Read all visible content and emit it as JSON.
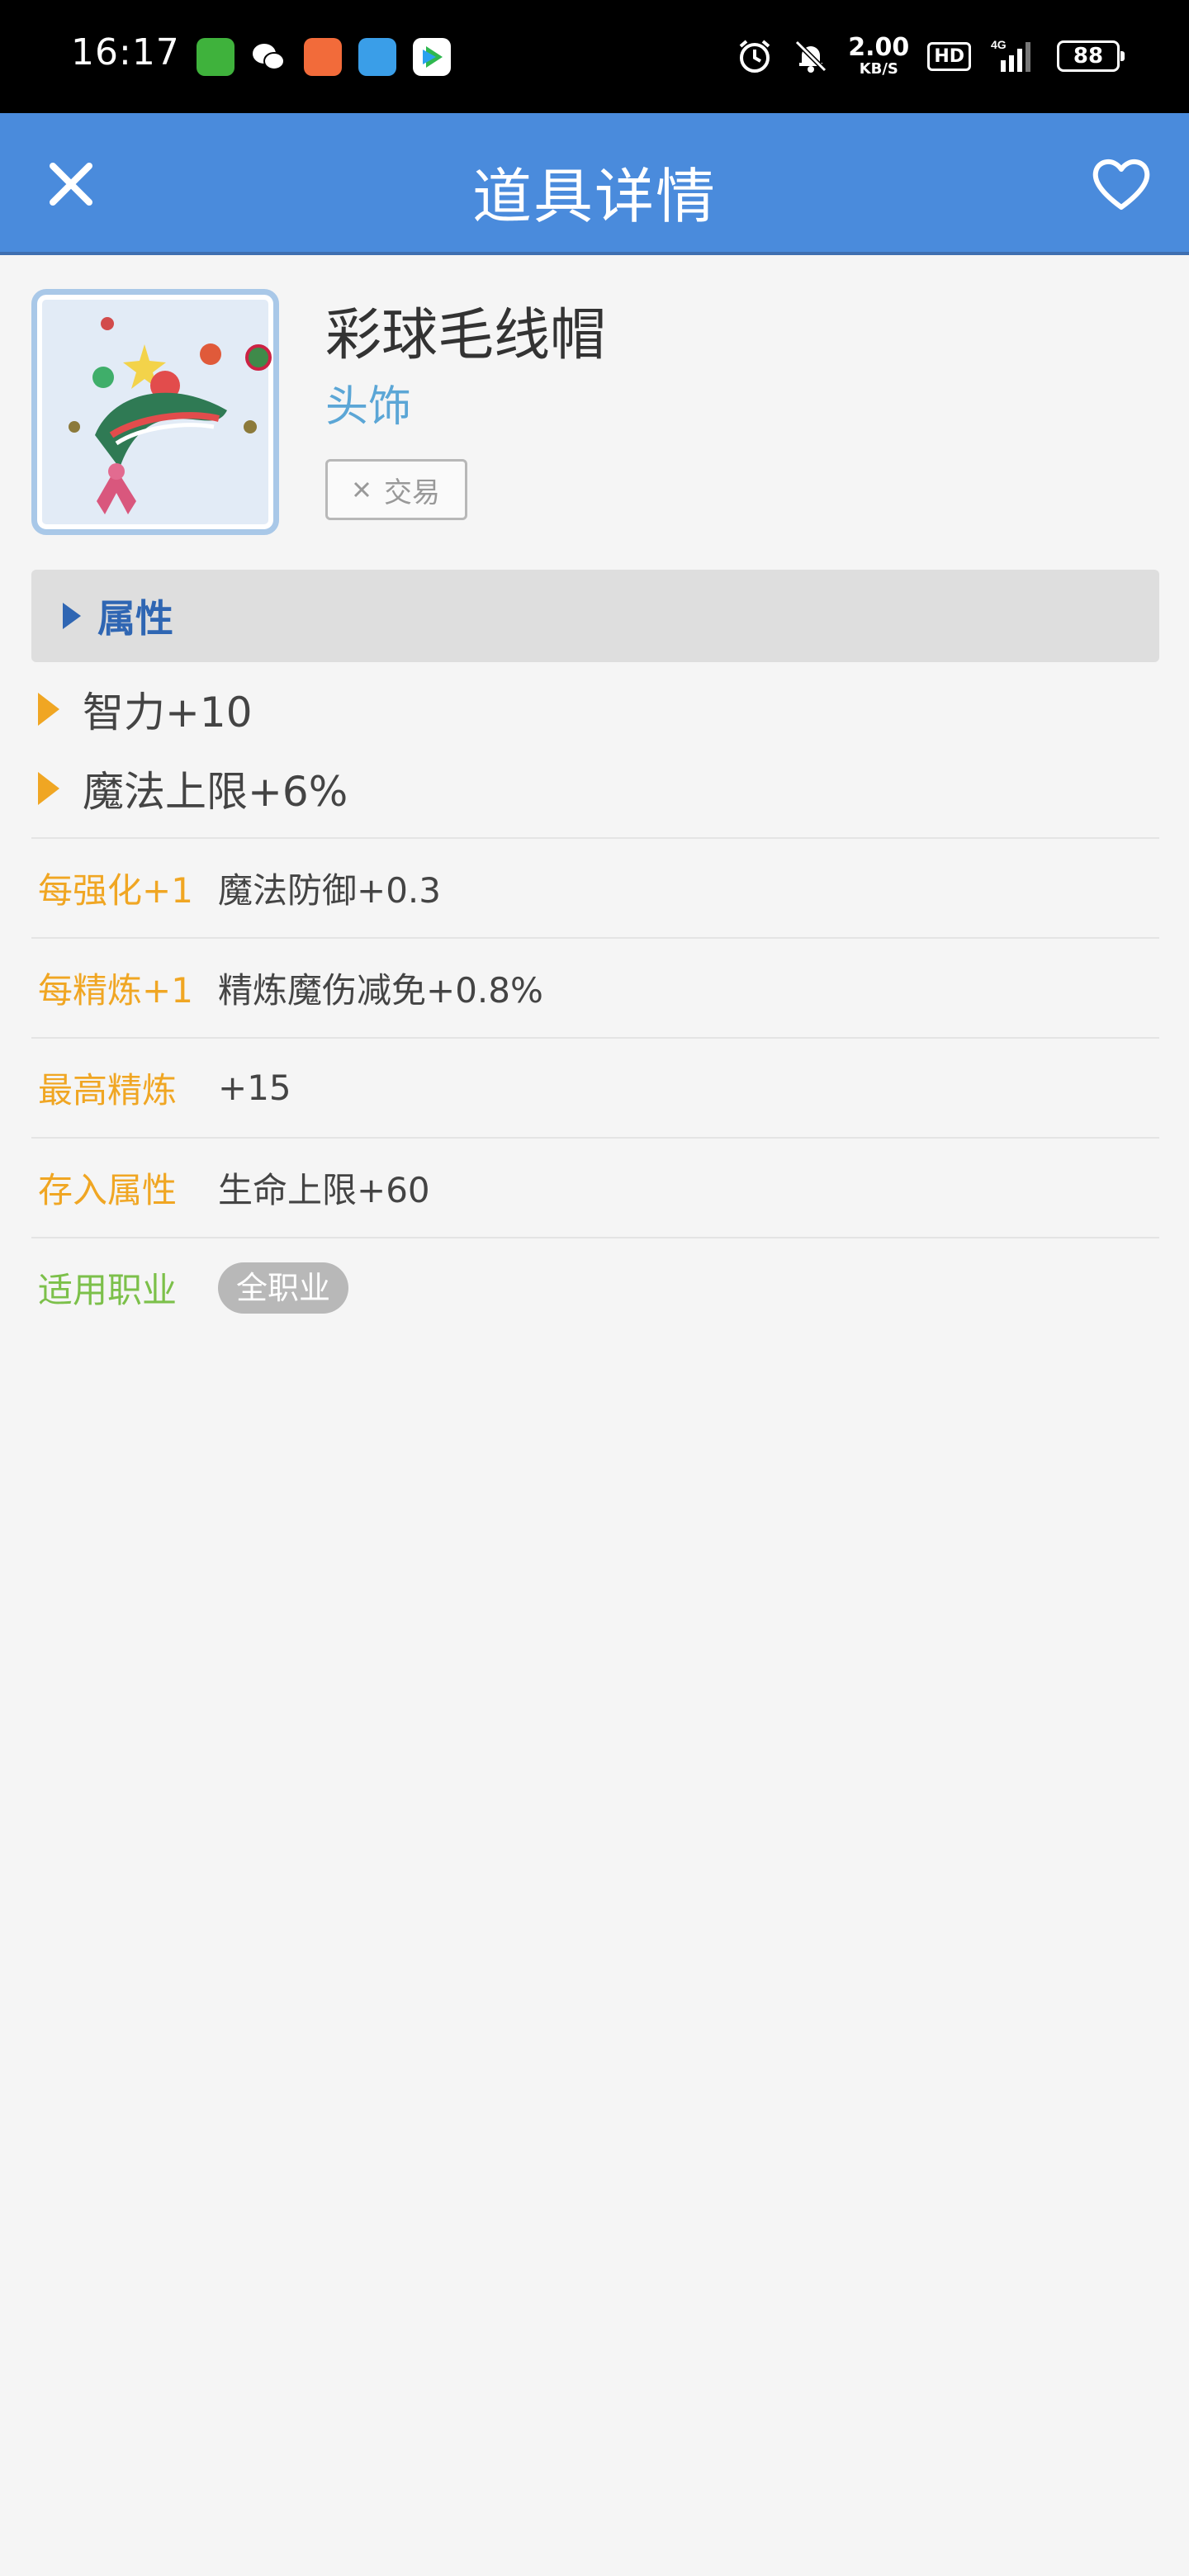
{
  "status_bar": {
    "time": "16:17",
    "net_speed_value": "2.00",
    "net_speed_unit": "KB/S",
    "hd": "HD",
    "network": "4G",
    "battery": "88"
  },
  "app_bar": {
    "title": "道具详情",
    "close_icon": "close-icon",
    "favorite_icon": "heart-outline-icon",
    "color": "#4a8bdc"
  },
  "item": {
    "name": "彩球毛线帽",
    "type": "头饰",
    "trade_tag": "交易",
    "trade_icon": "cross-icon"
  },
  "attributes_section": {
    "title": "属性",
    "items": [
      "智力+10",
      "魔法上限+6%"
    ]
  },
  "properties": [
    {
      "label": "每强化+1",
      "value": "魔法防御+0.3"
    },
    {
      "label": "每精炼+1",
      "value": "精炼魔伤减免+0.8%"
    },
    {
      "label": "最高精炼",
      "value": "+15"
    },
    {
      "label": "存入属性",
      "value": "生命上限+60"
    }
  ],
  "job": {
    "label": "适用职业",
    "value": "全职业"
  }
}
